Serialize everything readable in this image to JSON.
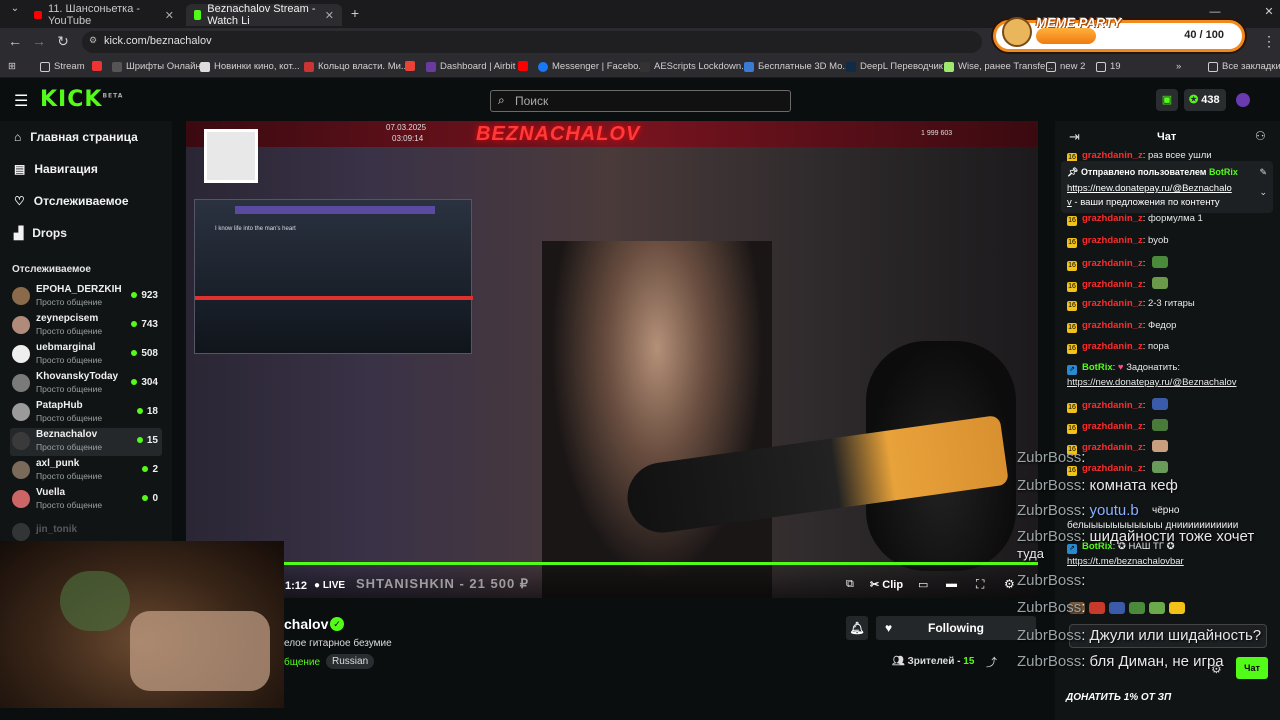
{
  "browser": {
    "tabs": [
      {
        "label": "11. Шансоньетка - YouTube",
        "favicon_color": "#ff0000"
      },
      {
        "label": "Beznachalov Stream - Watch Li",
        "favicon_color": "#53fc18"
      }
    ],
    "url": "kick.com/beznachalov",
    "bookmarks": [
      {
        "label": "Stream",
        "icon": "folder-icon"
      },
      {
        "label": "",
        "icon": "app-icon"
      },
      {
        "label": "Шрифты Онлайн",
        "icon": "fonts-icon"
      },
      {
        "label": "Новинки кино, кот...",
        "icon": "film-icon"
      },
      {
        "label": "Кольцо власти. Ми...",
        "icon": "ring-icon"
      },
      {
        "label": "",
        "icon": "gmail-icon"
      },
      {
        "label": "Dashboard | Airbit",
        "icon": "airbit-icon"
      },
      {
        "label": "Messenger | Facebo...",
        "icon": "youtube-icon"
      },
      {
        "label": "AEScripts Lockdown...",
        "icon": "facebook-icon"
      },
      {
        "label": "Бесплатные 3D Mo...",
        "icon": "3d-icon"
      },
      {
        "label": "DeepL Переводчик",
        "icon": "deepl-icon"
      },
      {
        "label": "Wise, ранее Transfe...",
        "icon": "wise-icon"
      },
      {
        "label": "new 2",
        "icon": "folder-icon"
      },
      {
        "label": "19",
        "icon": "folder-icon"
      },
      {
        "label": "Все закладки",
        "icon": "folder-icon"
      }
    ]
  },
  "meme_party": {
    "title": "MEME PARTY",
    "count": "40 / 100"
  },
  "header": {
    "logo": "KICK",
    "logo_sup": "BETA",
    "search_placeholder": "Поиск",
    "points": "438"
  },
  "sidebar": {
    "nav": [
      {
        "label": "Главная страница",
        "icon": "home-icon"
      },
      {
        "label": "Навигация",
        "icon": "browse-icon"
      },
      {
        "label": "Отслеживаемое",
        "icon": "heart-icon"
      },
      {
        "label": "Drops",
        "icon": "drops-icon"
      }
    ],
    "following_title": "Отслеживаемое",
    "channels": [
      {
        "name": "EPOHA_DERZKIH",
        "category": "Просто общение",
        "viewers": "923",
        "color": "#8a6a4a"
      },
      {
        "name": "zeynepcisem",
        "category": "Просто общение",
        "viewers": "743",
        "color": "#b08a7a"
      },
      {
        "name": "uebmarginal",
        "category": "Просто общение",
        "viewers": "508",
        "color": "#eeeeee"
      },
      {
        "name": "KhovanskyToday",
        "category": "Просто общение",
        "viewers": "304",
        "color": "#7a7a7a"
      },
      {
        "name": "PatapHub",
        "category": "Просто общение",
        "viewers": "18",
        "color": "#9a9a9a"
      },
      {
        "name": "Beznachalov",
        "category": "Просто общение",
        "viewers": "15",
        "color": "#3a3a3a"
      },
      {
        "name": "axl_punk",
        "category": "Просто общение",
        "viewers": "2",
        "color": "#7a6a5a"
      },
      {
        "name": "Vuella",
        "category": "Просто общение",
        "viewers": "0",
        "color": "#c66"
      },
      {
        "name": "jin_tonik",
        "category": "",
        "viewers": "",
        "color": "#555"
      }
    ]
  },
  "video": {
    "overlay_title": "BEZNACHALOV",
    "date": "07.03.2025",
    "time": "03:09:14",
    "hud_count": "1 999 603",
    "game_lyric": "I know life into the man's heart",
    "elapsed": "1:12",
    "live_label": "LIVE",
    "donation_ticker": "SHTANISHKIN - 21 500 ₽",
    "clip_label": "Clip"
  },
  "stream_info": {
    "channel_name": "chalov",
    "title": "елое гитарное безумие",
    "category": "бщение",
    "tag": "Russian",
    "follow_label": "Following",
    "viewers_label": "Зрителей -",
    "viewers_count": "15"
  },
  "chat": {
    "title": "Чат",
    "pinned_by": "Отправлено пользователем",
    "pinned_user": "BotRix",
    "pinned_link": "https://new.donatepay.ru/@Beznachalo",
    "pinned_link_tail": "v",
    "pinned_text": " - ваши предложения по контенту",
    "messages": [
      {
        "user": "grazhdanin_z",
        "text": "раз всее ушли",
        "emote": ""
      },
      {
        "user": "grazhdanin_z",
        "text": "формулма 1",
        "emote": ""
      },
      {
        "user": "grazhdanin_z",
        "text": "byob",
        "emote": ""
      },
      {
        "user": "grazhdanin_z",
        "text": "",
        "emote": "#4a8a3a"
      },
      {
        "user": "grazhdanin_z",
        "text": "",
        "emote": "#6a9a4a"
      },
      {
        "user": "grazhdanin_z",
        "text": "2-3 гитары",
        "emote": ""
      },
      {
        "user": "grazhdanin_z",
        "text": "Федор",
        "emote": ""
      },
      {
        "user": "grazhdanin_z",
        "text": "пора",
        "emote": ""
      }
    ],
    "botrix_msg": {
      "user": "BotRix",
      "text": "Задонатить:",
      "link": "https://new.donatepay.ru/@Beznachalov"
    },
    "messages2": [
      {
        "user": "grazhdanin_z",
        "emote": "#3a5aaa"
      },
      {
        "user": "grazhdanin_z",
        "emote": "#4a7a3a"
      },
      {
        "user": "grazhdanin_z",
        "emote": "#c8a080"
      },
      {
        "user": "grazhdanin_z",
        "emote": "#6a9a5a"
      }
    ],
    "botrix_tg": {
      "user": "BotRix",
      "text": "НАШ ТГ",
      "link": "https://t.me/beznachalovbar"
    },
    "donate_footer": "ДОНАТИТЬ 1% ОТ ЗП",
    "send_label": "Чат"
  },
  "overlay_chat": [
    {
      "user": "ZubrBoss",
      "text": ""
    },
    {
      "user": "ZubrBoss",
      "text": "комната кеф"
    },
    {
      "user": "ZubrBoss",
      "text": "youtu.b"
    },
    {
      "user": "ZubrBoss",
      "text": "шидайности тоже хочет"
    },
    {
      "user": "",
      "text": "туда"
    },
    {
      "user": "ZubrBoss",
      "text": ""
    },
    {
      "user": "ZubrBoss",
      "text": ""
    },
    {
      "user": "ZubrBoss",
      "text": "Джули или шидайность?"
    },
    {
      "user": "ZubrBoss",
      "text": "бля Диман, не игра"
    }
  ],
  "overlay_extra": {
    "lyric1": "чёрно",
    "lyric2": "белыыыыыыыыыыы дниииииииииии"
  }
}
